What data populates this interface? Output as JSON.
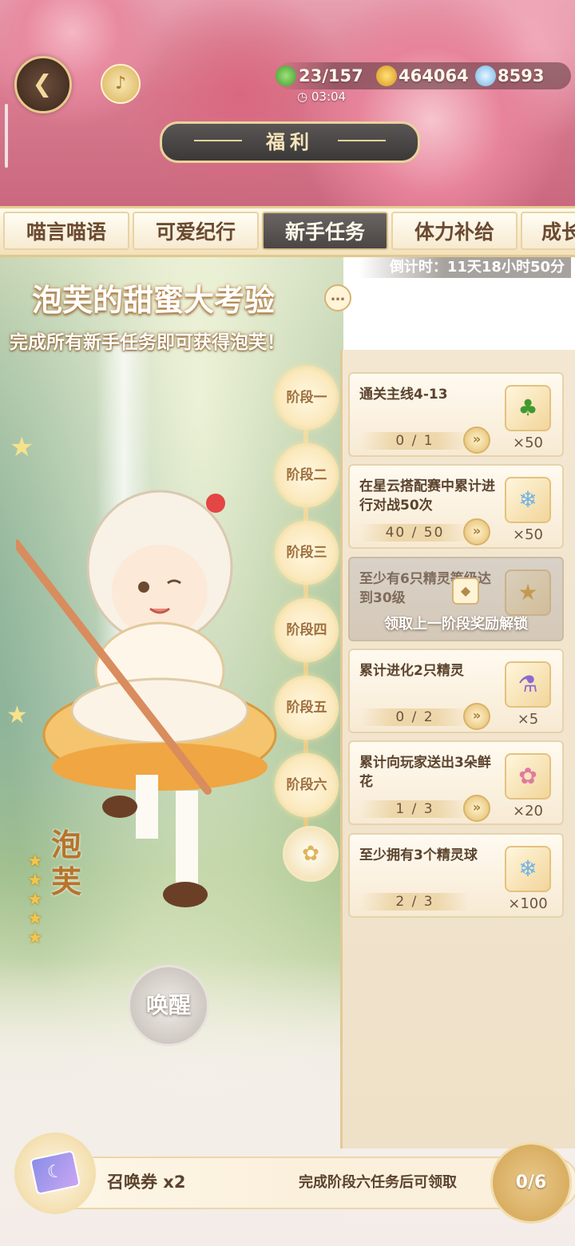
{
  "header": {
    "back_label": "返回",
    "resources": [
      {
        "icon": "clover-icon",
        "value": "23/157",
        "color": "#5cbf4a"
      },
      {
        "icon": "gold-coin-icon",
        "value": "464064",
        "color": "#f2b83a"
      },
      {
        "icon": "crystal-icon",
        "value": "8593",
        "color": "#8fc8ef"
      }
    ],
    "timer": "03:04"
  },
  "title": "福利",
  "tabs": [
    {
      "label": "喵言喵语",
      "active": false
    },
    {
      "label": "可爱纪行",
      "active": false
    },
    {
      "label": "新手任务",
      "active": true
    },
    {
      "label": "体力补给",
      "active": false
    },
    {
      "label": "成长",
      "active": false
    }
  ],
  "event": {
    "countdown": "倒计时：11天18小时50分",
    "title": "泡芙的甜蜜大考验",
    "subtitle": "完成所有新手任务即可获得泡芙！",
    "character_name": "泡芙",
    "stars": 5,
    "awaken_label": "唤醒"
  },
  "stages": [
    {
      "label": "阶段一"
    },
    {
      "label": "阶段二"
    },
    {
      "label": "阶段三"
    },
    {
      "label": "阶段四"
    },
    {
      "label": "阶段五"
    },
    {
      "label": "阶段六"
    }
  ],
  "tasks": [
    {
      "desc": "通关主线4-13",
      "progress": "0 / 1",
      "reward_icon": "clover-icon",
      "reward_qty": "×50",
      "has_go": true
    },
    {
      "desc": "在星云搭配赛中累计进行对战50次",
      "progress": "40 / 50",
      "reward_icon": "crystal-icon",
      "reward_qty": "×50",
      "has_go": true
    },
    {
      "desc": "至少有6只精灵等级达到30级",
      "progress": "",
      "reward_icon": "gold-coin-icon",
      "reward_qty": "",
      "has_go": false,
      "locked": true,
      "lock_text": "领取上一阶段奖励解锁"
    },
    {
      "desc": "累计进化2只精灵",
      "progress": "0 / 2",
      "reward_icon": "potion-icon",
      "reward_qty": "×5",
      "has_go": true
    },
    {
      "desc": "累计向玩家送出3朵鲜花",
      "progress": "1 / 3",
      "reward_icon": "flower-icon",
      "reward_qty": "×20",
      "has_go": true
    },
    {
      "desc": "至少拥有3个精灵球",
      "progress": "2 / 3",
      "reward_icon": "crystal-icon",
      "reward_qty": "×100",
      "has_go": false
    }
  ],
  "bottom": {
    "ticket_label": "召唤券 x2",
    "claim_hint": "完成阶段六任务后可领取",
    "progress": "0/6"
  }
}
